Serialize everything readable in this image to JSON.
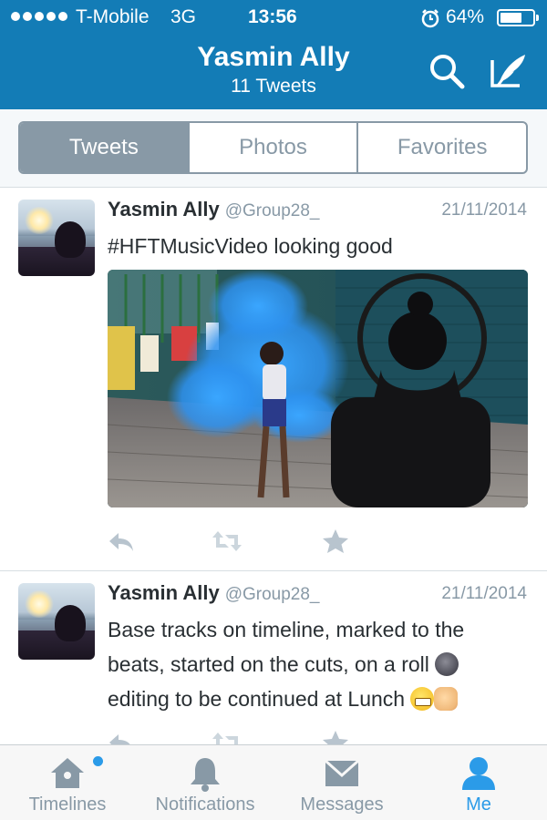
{
  "status_bar": {
    "carrier": "T-Mobile",
    "network": "3G",
    "time": "13:56",
    "battery": "64%",
    "battery_level": 0.64,
    "signal_bars": 5
  },
  "header": {
    "title": "Yasmin Ally",
    "subtitle": "11 Tweets",
    "color": "#137cb6"
  },
  "segments": [
    {
      "label": "Tweets",
      "active": true
    },
    {
      "label": "Photos",
      "active": false
    },
    {
      "label": "Favorites",
      "active": false
    }
  ],
  "tweets": [
    {
      "name": "Yasmin Ally",
      "handle": "@Group28_",
      "date": "21/11/2014",
      "text": "#HFTMusicVideo looking good",
      "has_media": true
    },
    {
      "name": "Yasmin Ally",
      "handle": "@Group28_",
      "date": "21/11/2014",
      "text_line1": "Base tracks on timeline, marked to the",
      "text_line2": "beats, started on the cuts, on a roll",
      "text_line3": "editing to be continued at Lunch",
      "emojis": [
        "new-moon-face-emoji",
        "grimacing-face-emoji",
        "fist-bump-emoji"
      ]
    }
  ],
  "tabbar": {
    "items": [
      {
        "label": "Timelines",
        "icon": "home-icon",
        "has_badge_dot": true
      },
      {
        "label": "Notifications",
        "icon": "bell-icon"
      },
      {
        "label": "Messages",
        "icon": "envelope-icon"
      },
      {
        "label": "Me",
        "icon": "person-icon",
        "active": true
      }
    ],
    "active_color": "#2b9be8",
    "inactive_color": "#8899a6"
  }
}
